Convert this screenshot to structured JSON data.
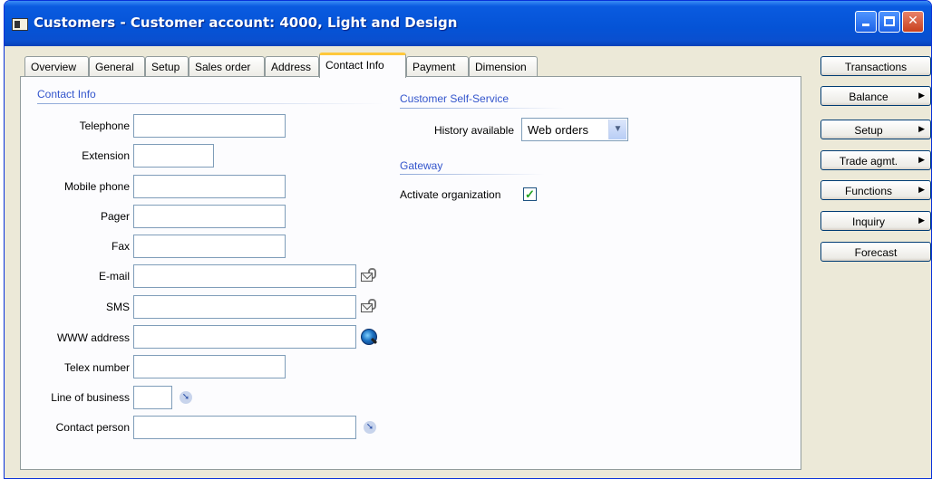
{
  "window": {
    "title": "Customers - Customer account: 4000, Light and Design"
  },
  "tabs": [
    {
      "label": "Overview"
    },
    {
      "label": "General"
    },
    {
      "label": "Setup"
    },
    {
      "label": "Sales order"
    },
    {
      "label": "Address"
    },
    {
      "label": "Contact Info"
    },
    {
      "label": "Payment"
    },
    {
      "label": "Dimension"
    }
  ],
  "active_tab": "Contact Info",
  "contact_info": {
    "heading": "Contact Info",
    "fields": {
      "telephone": {
        "label": "Telephone",
        "value": ""
      },
      "extension": {
        "label": "Extension",
        "value": ""
      },
      "mobile_phone": {
        "label": "Mobile phone",
        "value": ""
      },
      "pager": {
        "label": "Pager",
        "value": ""
      },
      "fax": {
        "label": "Fax",
        "value": ""
      },
      "email": {
        "label": "E-mail",
        "value": ""
      },
      "sms": {
        "label": "SMS",
        "value": ""
      },
      "www": {
        "label": "WWW address",
        "value": ""
      },
      "telex": {
        "label": "Telex number",
        "value": ""
      },
      "line_of_business": {
        "label": "Line of business",
        "value": ""
      },
      "contact_person": {
        "label": "Contact person",
        "value": ""
      }
    }
  },
  "self_service": {
    "heading": "Customer Self-Service",
    "history_label": "History available",
    "history_value": "Web orders"
  },
  "gateway": {
    "heading": "Gateway",
    "activate_label": "Activate organization",
    "activate_checked": true
  },
  "buttons": {
    "transactions": "Transactions",
    "balance": "Balance",
    "setup": "Setup",
    "trade_agmt": "Trade agmt.",
    "functions": "Functions",
    "inquiry": "Inquiry",
    "forecast": "Forecast"
  },
  "icons": {
    "minimize": "minimize-icon",
    "maximize": "maximize-icon",
    "close": "close-icon",
    "email": "email-attachment-icon",
    "sms": "sms-attachment-icon",
    "www": "web-browse-icon",
    "lookup": "lookup-arrow-icon"
  },
  "colors": {
    "titlebar": "#0553d6",
    "section_heading": "#3355cc",
    "active_tab_accent": "#ffc83c",
    "check": "#21a121"
  }
}
